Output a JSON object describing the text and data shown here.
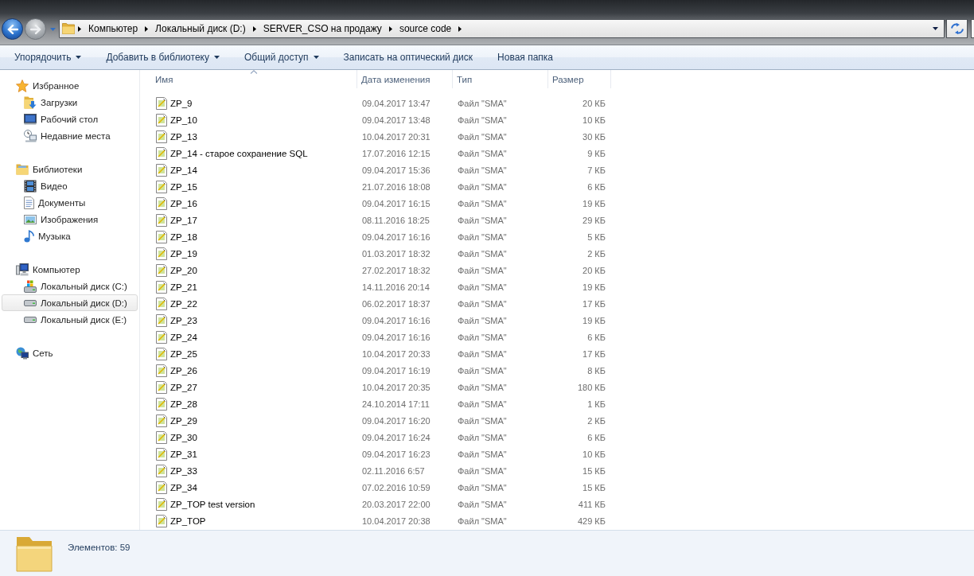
{
  "navigation": [
    {
      "kind": "back",
      "disabled": false
    },
    {
      "kind": "forward",
      "disabled": true
    }
  ],
  "address_bar": {
    "path": [
      "Компьютер",
      "Локальный диск (D:)",
      "SERVER_CSO на продажу",
      "source code"
    ]
  },
  "toolbar": [
    {
      "label": "Упорядочить",
      "kind": "menu"
    },
    {
      "label": "Добавить в библиотеку",
      "kind": "menu"
    },
    {
      "label": "Общий доступ",
      "kind": "menu"
    },
    {
      "label": "Записать на оптический диск",
      "kind": "command"
    },
    {
      "label": "Новая папка",
      "kind": "command"
    }
  ],
  "sidebar": {
    "groups": [
      {
        "label": "Избранное",
        "kind": "favorites",
        "selected": false,
        "children": [
          {
            "label": "Загрузки",
            "kind": "downloads",
            "selected": false
          },
          {
            "label": "Рабочий стол",
            "kind": "desktop",
            "selected": false
          },
          {
            "label": "Недавние места",
            "kind": "recent",
            "selected": false
          }
        ]
      },
      {
        "label": "Библиотеки",
        "kind": "libraries",
        "selected": false,
        "children": [
          {
            "label": "Видео",
            "kind": "video",
            "selected": false
          },
          {
            "label": "Документы",
            "kind": "documents",
            "selected": false
          },
          {
            "label": "Изображения",
            "kind": "pictures",
            "selected": false
          },
          {
            "label": "Музыка",
            "kind": "music",
            "selected": false
          }
        ]
      },
      {
        "label": "Компьютер",
        "kind": "computer",
        "selected": false,
        "children": [
          {
            "label": "Локальный диск (C:)",
            "kind": "system_drive",
            "selected": false
          },
          {
            "label": "Локальный диск (D:)",
            "kind": "drive",
            "selected": true
          },
          {
            "label": "Локальный диск (E:)",
            "kind": "drive",
            "selected": false
          }
        ]
      },
      {
        "label": "Сеть",
        "kind": "network",
        "selected": false
      }
    ]
  },
  "file_list": {
    "columns": [
      {
        "label": "Имя",
        "sorted": true
      },
      {
        "label": "Дата изменения",
        "sorted": false
      },
      {
        "label": "Тип",
        "sorted": false
      },
      {
        "label": "Размер",
        "sorted": false
      }
    ],
    "rows": [
      {
        "name": "ZP_9",
        "date_modified": "09.04.2017 13:47",
        "type": "Файл \"SMA\"",
        "size": "20 КБ"
      },
      {
        "name": "ZP_10",
        "date_modified": "09.04.2017 13:48",
        "type": "Файл \"SMA\"",
        "size": "10 КБ"
      },
      {
        "name": "ZP_13",
        "date_modified": "10.04.2017 20:31",
        "type": "Файл \"SMA\"",
        "size": "30 КБ"
      },
      {
        "name": "ZP_14 - старое сохранение SQL",
        "date_modified": "17.07.2016 12:15",
        "type": "Файл \"SMA\"",
        "size": "9 КБ"
      },
      {
        "name": "ZP_14",
        "date_modified": "09.04.2017 15:36",
        "type": "Файл \"SMA\"",
        "size": "7 КБ"
      },
      {
        "name": "ZP_15",
        "date_modified": "21.07.2016 18:08",
        "type": "Файл \"SMA\"",
        "size": "6 КБ"
      },
      {
        "name": "ZP_16",
        "date_modified": "09.04.2017 16:15",
        "type": "Файл \"SMA\"",
        "size": "19 КБ"
      },
      {
        "name": "ZP_17",
        "date_modified": "08.11.2016 18:25",
        "type": "Файл \"SMA\"",
        "size": "29 КБ"
      },
      {
        "name": "ZP_18",
        "date_modified": "09.04.2017 16:16",
        "type": "Файл \"SMA\"",
        "size": "5 КБ"
      },
      {
        "name": "ZP_19",
        "date_modified": "01.03.2017 18:32",
        "type": "Файл \"SMA\"",
        "size": "2 КБ"
      },
      {
        "name": "ZP_20",
        "date_modified": "27.02.2017 18:32",
        "type": "Файл \"SMA\"",
        "size": "20 КБ"
      },
      {
        "name": "ZP_21",
        "date_modified": "14.11.2016 20:14",
        "type": "Файл \"SMA\"",
        "size": "19 КБ"
      },
      {
        "name": "ZP_22",
        "date_modified": "06.02.2017 18:37",
        "type": "Файл \"SMA\"",
        "size": "17 КБ"
      },
      {
        "name": "ZP_23",
        "date_modified": "09.04.2017 16:16",
        "type": "Файл \"SMA\"",
        "size": "19 КБ"
      },
      {
        "name": "ZP_24",
        "date_modified": "09.04.2017 16:16",
        "type": "Файл \"SMA\"",
        "size": "6 КБ"
      },
      {
        "name": "ZP_25",
        "date_modified": "10.04.2017 20:33",
        "type": "Файл \"SMA\"",
        "size": "17 КБ"
      },
      {
        "name": "ZP_26",
        "date_modified": "09.04.2017 16:19",
        "type": "Файл \"SMA\"",
        "size": "8 КБ"
      },
      {
        "name": "ZP_27",
        "date_modified": "10.04.2017 20:35",
        "type": "Файл \"SMA\"",
        "size": "180 КБ"
      },
      {
        "name": "ZP_28",
        "date_modified": "24.10.2014 17:11",
        "type": "Файл \"SMA\"",
        "size": "1 КБ"
      },
      {
        "name": "ZP_29",
        "date_modified": "09.04.2017 16:20",
        "type": "Файл \"SMA\"",
        "size": "2 КБ"
      },
      {
        "name": "ZP_30",
        "date_modified": "09.04.2017 16:24",
        "type": "Файл \"SMA\"",
        "size": "6 КБ"
      },
      {
        "name": "ZP_31",
        "date_modified": "09.04.2017 16:23",
        "type": "Файл \"SMA\"",
        "size": "10 КБ"
      },
      {
        "name": "ZP_33",
        "date_modified": "02.11.2016 6:57",
        "type": "Файл \"SMA\"",
        "size": "15 КБ"
      },
      {
        "name": "ZP_34",
        "date_modified": "07.02.2016 10:59",
        "type": "Файл \"SMA\"",
        "size": "15 КБ"
      },
      {
        "name": "ZP_TOP test version",
        "date_modified": "20.03.2017 22:00",
        "type": "Файл \"SMA\"",
        "size": "411 КБ"
      },
      {
        "name": "ZP_TOP",
        "date_modified": "10.04.2017 20:38",
        "type": "Файл \"SMA\"",
        "size": "429 КБ"
      }
    ]
  },
  "status_bar": {
    "item_count": "Элементов: 59"
  }
}
